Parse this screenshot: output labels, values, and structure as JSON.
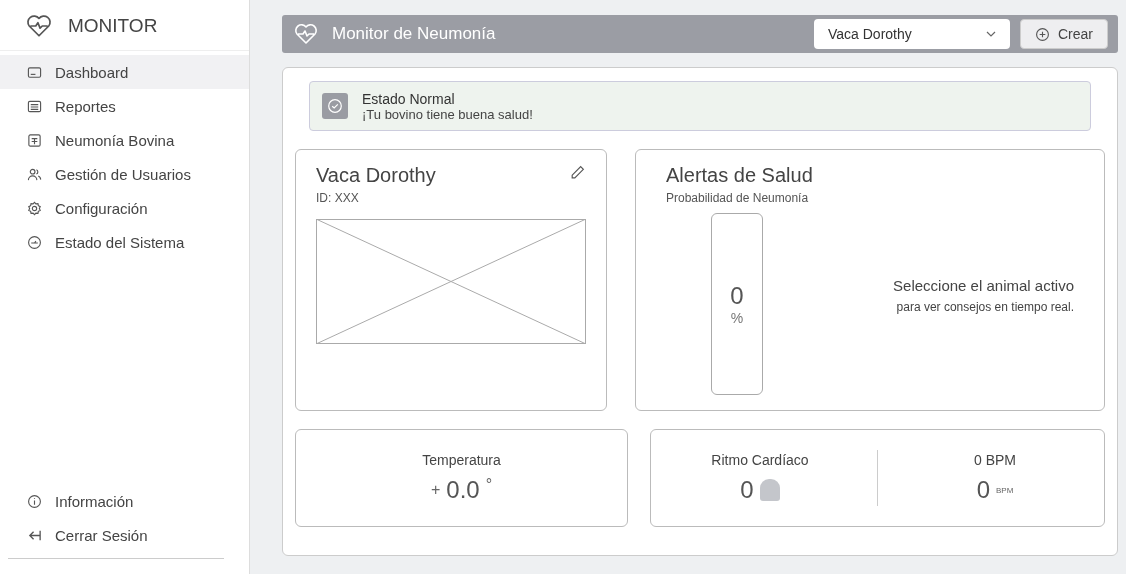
{
  "sidebar": {
    "logo": "MONITOR",
    "items": [
      {
        "label": "Dashboard",
        "selected": true
      },
      {
        "label": "Reportes",
        "selected": false
      },
      {
        "label": "Neumonía Bovina",
        "selected": false
      },
      {
        "label": "Gestión de Usuarios",
        "selected": false
      },
      {
        "label": "Configuración",
        "selected": false
      },
      {
        "label": "Estado del Sistema",
        "selected": false
      }
    ],
    "footer_items": [
      {
        "label": "Información"
      },
      {
        "label": "Cerrar Sesión"
      }
    ]
  },
  "header": {
    "title": "Monitor de Neumonía",
    "animal_select": {
      "value": "Vaca Dorothy"
    },
    "create_button": "Crear"
  },
  "status_alert": {
    "title": "Estado Normal",
    "message": "¡Tu bovino tiene buena salud!"
  },
  "animal_card": {
    "name": "Vaca Dorothy",
    "id": "ID: XXX"
  },
  "health_alerts": {
    "title": "Alertas de Salud",
    "subtitle": "Probabilidad de Neumonía",
    "gauge": {
      "value": "0",
      "unit": "%",
      "level": 0
    },
    "hint_line_1": "Seleccione el animal activo",
    "hint_line_2": "para ver consejos en tiempo real."
  },
  "temperature": {
    "label": "Temperatura",
    "sign": "+",
    "value": "0.0",
    "unit": "°"
  },
  "heart_rate": {
    "label": "Ritmo Cardíaco",
    "value": "0",
    "bpm_label": "0 BPM",
    "bpm_value": "0",
    "bpm_unit": "BPM"
  }
}
